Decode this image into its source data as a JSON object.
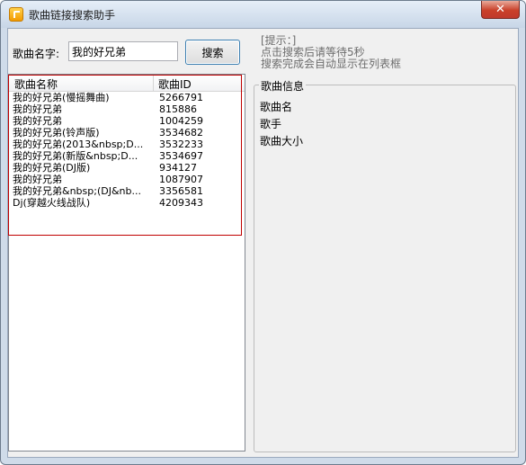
{
  "window": {
    "title": "歌曲链接搜索助手",
    "close_symbol": "✕"
  },
  "search": {
    "label": "歌曲名字:",
    "value": "我的好兄弟",
    "button_label": "搜索"
  },
  "hint": {
    "lines": [
      "[提示：]",
      "点击搜索后请等待5秒",
      "搜索完成会自动显示在列表框"
    ]
  },
  "song_list": {
    "columns": [
      "歌曲名称",
      "歌曲ID"
    ],
    "rows": [
      {
        "name": "我的好兄弟(慢摇舞曲)",
        "id": "5266791"
      },
      {
        "name": "我的好兄弟",
        "id": "815886"
      },
      {
        "name": "我的好兄弟",
        "id": "1004259"
      },
      {
        "name": "我的好兄弟(铃声版)",
        "id": "3534682"
      },
      {
        "name": "我的好兄弟(2013&nbsp;D...",
        "id": "3532233"
      },
      {
        "name": "我的好兄弟(新版&nbsp;D...",
        "id": "3534697"
      },
      {
        "name": "我的好兄弟(DJ版)",
        "id": "934127"
      },
      {
        "name": "我的好兄弟",
        "id": "1087907"
      },
      {
        "name": "我的好兄弟&nbsp;(DJ&nb...",
        "id": "3356581"
      },
      {
        "name": "Dj(穿越火线战队)",
        "id": "4209343"
      }
    ]
  },
  "info": {
    "title": "歌曲信息",
    "fields": [
      "歌曲名",
      "歌手",
      "歌曲大小"
    ]
  },
  "colors": {
    "selection_border": "#c00000",
    "button_focus_border": "#3c7fb1",
    "hint_text": "#6d6d6d"
  }
}
